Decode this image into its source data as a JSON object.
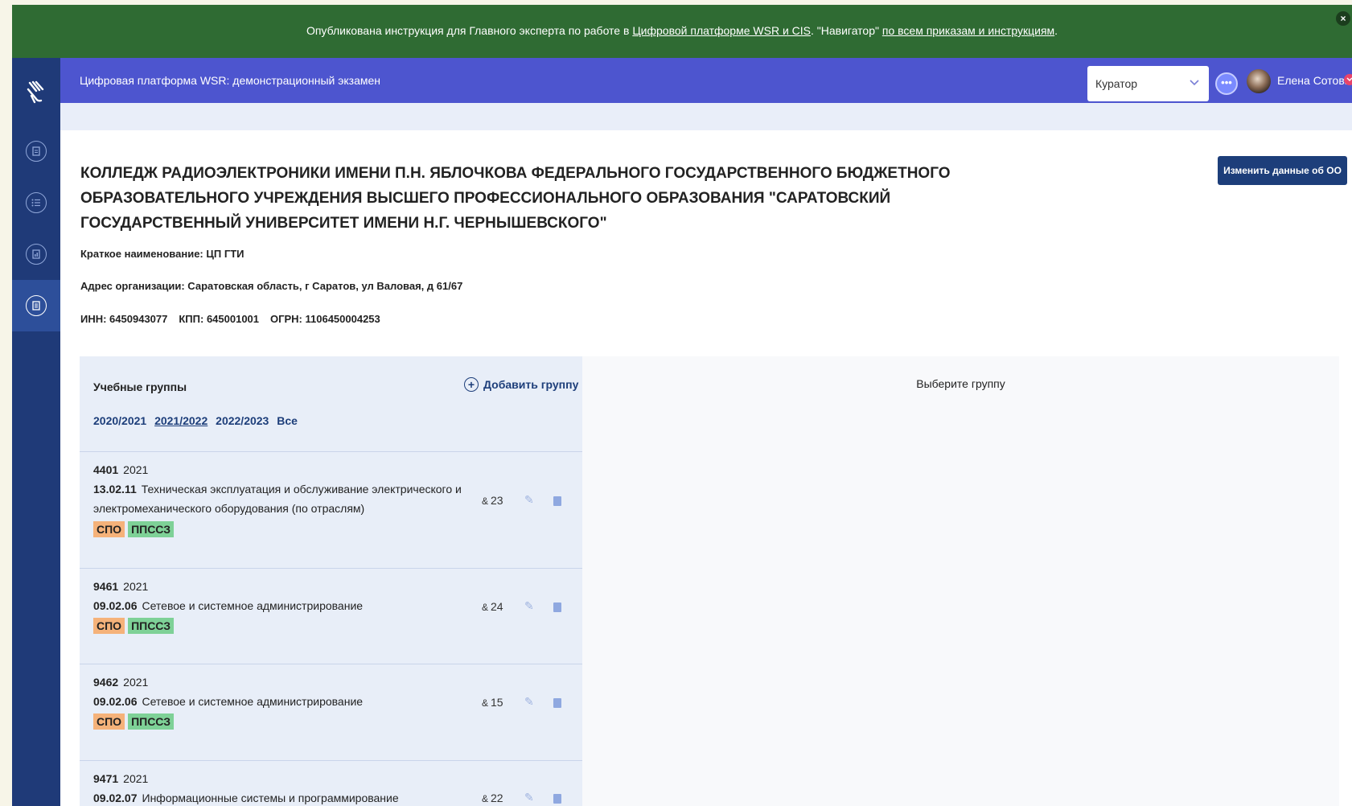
{
  "notice": {
    "text_before": "Опубликована инструкция для Главного эксперта по работе в ",
    "link1": "Цифровой платформе WSR и CIS",
    "text_middle": ". \"Навигатор\" ",
    "link2": "по всем приказам и инструкциям",
    "text_after": ".",
    "close": "×"
  },
  "header": {
    "title": "Цифровая платформа WSR: демонстрационный экзамен",
    "role": "Куратор",
    "user_name": "Елена Сотова"
  },
  "organization": {
    "title": "КОЛЛЕДЖ РАДИОЭЛЕКТРОНИКИ ИМЕНИ П.Н. ЯБЛОЧКОВА ФЕДЕРАЛЬНОГО ГОСУДАРСТВЕННОГО БЮДЖЕТНОГО ОБРАЗОВАТЕЛЬНОГО УЧРЕЖДЕНИЯ ВЫСШЕГО ПРОФЕССИОНАЛЬНОГО ОБРАЗОВАНИЯ \"САРАТОВСКИЙ ГОСУДАРСТВЕННЫЙ УНИВЕРСИТЕТ ИМЕНИ Н.Г. ЧЕРНЫШЕВСКОГО\"",
    "edit_button": "Изменить данные об ОО",
    "short_name": "Краткое наименование: ЦП ГТИ",
    "address": "Адрес организации: Саратовская область, г Саратов, ул Валовая, д 61/67",
    "inn": "ИНН: 6450943077",
    "kpp": "КПП: 645001001",
    "ogrn": "ОГРН: 1106450004253"
  },
  "groups": {
    "heading": "Учебные группы",
    "add_label": "Добавить группу",
    "years": [
      "2020/2021",
      "2021/2022",
      "2022/2023",
      "Все"
    ],
    "selected_year": "2021/2022",
    "items": [
      {
        "code": "4401",
        "year": "2021",
        "spec_code": "13.02.11",
        "spec_name": "Техническая эксплуатация и обслуживание электрического и электромеханического оборудования (по отраслям)",
        "tag1": "СПО",
        "tag2": "ППССЗ",
        "count": "23"
      },
      {
        "code": "9461",
        "year": "2021",
        "spec_code": "09.02.06",
        "spec_name": "Сетевое и системное администрирование",
        "tag1": "СПО",
        "tag2": "ППССЗ",
        "count": "24"
      },
      {
        "code": "9462",
        "year": "2021",
        "spec_code": "09.02.06",
        "spec_name": "Сетевое и системное администрирование",
        "tag1": "СПО",
        "tag2": "ППССЗ",
        "count": "15"
      },
      {
        "code": "9471",
        "year": "2021",
        "spec_code": "09.02.07",
        "spec_name": "Информационные системы и программирование",
        "tag1": "",
        "tag2": "",
        "count": "22"
      }
    ]
  },
  "right_panel": {
    "hint": "Выберите группу"
  }
}
